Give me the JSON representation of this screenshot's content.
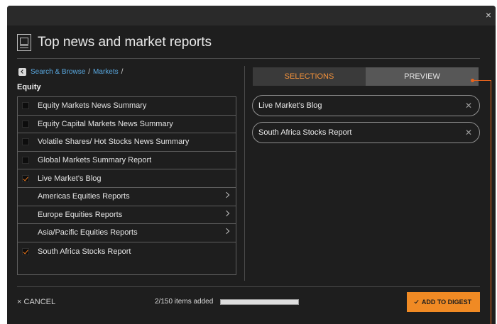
{
  "window": {
    "close_label": "×"
  },
  "header": {
    "title": "Top news and market reports"
  },
  "breadcrumb": {
    "items": [
      "Search & Browse",
      "Markets"
    ],
    "separator": "/"
  },
  "section": {
    "title": "Equity"
  },
  "list": {
    "items": [
      {
        "label": "Equity Markets News Summary",
        "type": "checkbox",
        "checked": false
      },
      {
        "label": "Equity Capital Markets News Summary",
        "type": "checkbox",
        "checked": false
      },
      {
        "label": "Volatile Shares/ Hot Stocks News Summary",
        "type": "checkbox",
        "checked": false
      },
      {
        "label": "Global Markets Summary Report",
        "type": "checkbox",
        "checked": false
      },
      {
        "label": "Live Market's Blog",
        "type": "checkbox",
        "checked": true
      },
      {
        "label": "Americas Equities Reports",
        "type": "folder"
      },
      {
        "label": "Europe Equities Reports",
        "type": "folder"
      },
      {
        "label": "Asia/Pacific Equities Reports",
        "type": "folder"
      },
      {
        "label": "South Africa Stocks Report",
        "type": "checkbox",
        "checked": true
      }
    ]
  },
  "tabs": [
    {
      "label": "SELECTIONS",
      "active": true
    },
    {
      "label": "PREVIEW",
      "active": false
    }
  ],
  "selections": [
    {
      "label": "Live Market's Blog"
    },
    {
      "label": "South Africa Stocks Report"
    }
  ],
  "footer": {
    "cancel_label": "CANCEL",
    "cancel_icon": "×",
    "count_text": "2/150 items added",
    "progress_fraction": 1.0,
    "digest_label": "ADD TO DIGEST"
  },
  "colors": {
    "accent": "#f08a24",
    "callout": "#e8641e",
    "link": "#59a8e0",
    "background": "#1e1e1e"
  }
}
